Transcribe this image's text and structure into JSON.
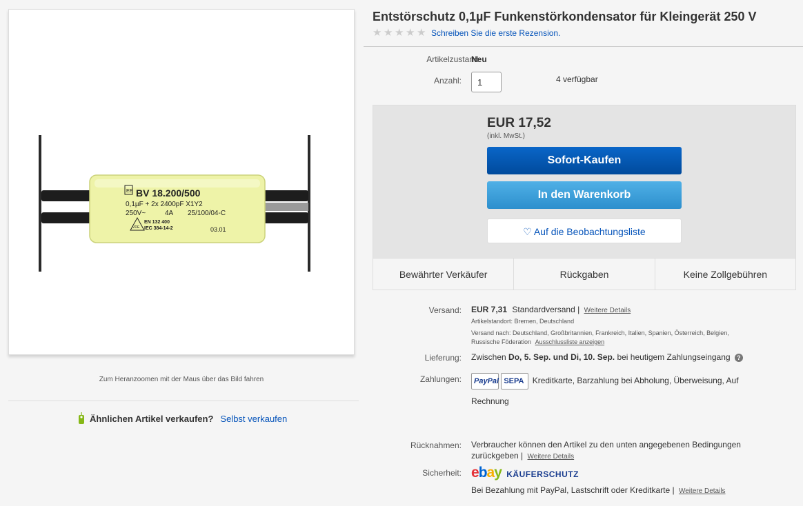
{
  "product": {
    "title": "Entstörschutz 0,1µF Funkenstörkondensator für Kleingerät 250 V",
    "review_link": "Schreiben Sie die erste Rezension.",
    "rating": 0,
    "capacitor_label": {
      "line1": "BV 18.200/500",
      "line2": "0,1µF + 2x 2400pF X1Y2",
      "line3a": "250V~",
      "line3b": "4A",
      "line3c": "25/100/04-C",
      "line4": "EN 132 400",
      "line5": "IEC 384-14-2",
      "date": "03.01",
      "logo_mark": "VDE"
    }
  },
  "left": {
    "zoom_hint": "Zum Heranzoomen mit der Maus über das Bild fahren",
    "sell_question": "Ähnlichen Artikel verkaufen?",
    "sell_link": "Selbst verkaufen"
  },
  "condition": {
    "label": "Artikelzustand:",
    "value": "Neu"
  },
  "quantity": {
    "label": "Anzahl:",
    "value": "1",
    "available": "4 verfügbar"
  },
  "buy": {
    "price": "EUR 17,52",
    "price_note": "(inkl. MwSt.)",
    "buy_now": "Sofort-Kaufen",
    "add_cart": "In den Warenkorb",
    "watch": "Auf die Beobachtungsliste"
  },
  "badges": [
    "Bewährter Verkäufer",
    "Rückgaben",
    "Keine Zollgebühren"
  ],
  "shipping": {
    "label": "Versand:",
    "cost": "EUR 7,31",
    "method": "Standardversand |",
    "details_link": "Weitere Details",
    "location": "Artikelstandort:  Bremen, Deutschland",
    "ships_to_prefix": "Versand nach:  Deutschland, Großbritannien, Frankreich, Italien, Spanien, Österreich, Belgien,",
    "ships_to_suffix": "Russische Föderation",
    "exclusions_link": "Ausschlussliste anzeigen"
  },
  "delivery": {
    "label": "Lieferung:",
    "prefix": "Zwischen",
    "date_from": "Do, 5. Sep.",
    "and": "und",
    "date_to": "Di, 10. Sep.",
    "suffix": "bei heutigem Zahlungseingang"
  },
  "payments": {
    "label": "Zahlungen:",
    "paypal": "PayPal",
    "sepa": "SEPA",
    "methods_line1": "Kreditkarte, Barzahlung bei Abholung, Überweisung, Auf",
    "methods_line2": "Rechnung"
  },
  "returns": {
    "label": "Rücknahmen:",
    "line1": "Verbraucher können den Artikel zu den unten angegebenen Bedingungen",
    "line2": "zurückgeben |",
    "details_link": "Weitere Details"
  },
  "security": {
    "label": "Sicherheit:",
    "ebay_e": "e",
    "ebay_b": "b",
    "ebay_a": "a",
    "ebay_y": "y",
    "protection": "KÄUFERSCHUTZ",
    "line": "Bei Bezahlung mit PayPal, Lastschrift oder Kreditkarte |",
    "details_link": "Weitere Details"
  },
  "colors": {
    "link": "#0654ba",
    "buy_button": "#004a9c",
    "cart_button": "#2d8fcd",
    "capacitor_body": "#eef3a8"
  }
}
